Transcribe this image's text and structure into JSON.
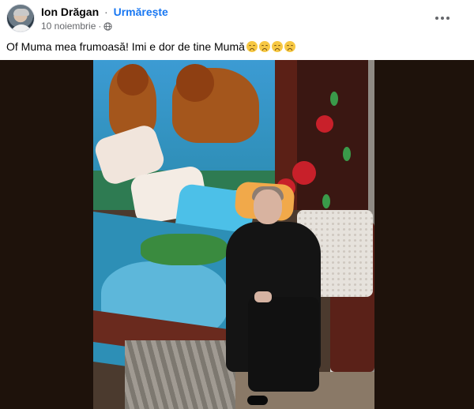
{
  "post": {
    "author_name": "Ion Drăgan",
    "separator": "·",
    "follow_label": "Urmărește",
    "date": "10 noiembrie",
    "meta_separator": "·",
    "caption_text": "Of Muma mea frumoasă! Imi e dor de tine Mumă",
    "caption_emojis": [
      "sad-face-emoji",
      "sad-face-emoji",
      "sad-face-emoji",
      "sad-face-emoji"
    ],
    "privacy_icon": "globe-icon",
    "menu_icon": "more-options-icon"
  },
  "colors": {
    "follow_blue": "#1877f2",
    "meta_gray": "#65676b",
    "photo_background": "#1e120b"
  }
}
